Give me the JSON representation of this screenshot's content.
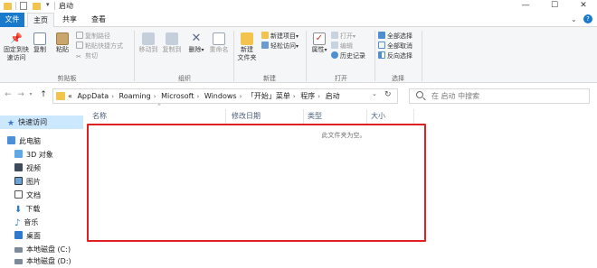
{
  "window": {
    "title": "启动",
    "min_glyph": "—",
    "max_glyph": "☐",
    "close_glyph": "✕"
  },
  "tabs": {
    "file": "文件",
    "home": "主页",
    "share": "共享",
    "view": "查看"
  },
  "ribbon": {
    "clipboard": {
      "pin": "固定到快\n速访问",
      "copy": "复制",
      "paste": "粘贴",
      "copy_path": "复制路径",
      "paste_shortcut": "粘贴快捷方式",
      "cut": "剪切",
      "label": "剪贴板"
    },
    "organize": {
      "move_to": "移动到",
      "copy_to": "复制到",
      "delete": "删除",
      "rename": "重命名",
      "label": "组织"
    },
    "new": {
      "new_folder": "新建\n文件夹",
      "new_item": "新建项目",
      "easy_access": "轻松访问",
      "label": "新建"
    },
    "open": {
      "properties": "属性",
      "open": "打开",
      "edit": "编辑",
      "history": "历史记录",
      "label": "打开"
    },
    "select": {
      "select_all": "全部选择",
      "select_none": "全部取消",
      "invert": "反向选择",
      "label": "选择"
    }
  },
  "address": {
    "crumbs": [
      "«",
      "AppData",
      "Roaming",
      "Microsoft",
      "Windows",
      "「开始」菜单",
      "程序",
      "启动"
    ],
    "search_placeholder": "在 启动 中搜索"
  },
  "navpane": {
    "quick_access": "快速访问",
    "this_pc": "此电脑",
    "objects_3d": "3D 对象",
    "videos": "视频",
    "pictures": "图片",
    "documents": "文档",
    "downloads": "下载",
    "music": "音乐",
    "desktop": "桌面",
    "disk_c": "本地磁盘 (C:)",
    "disk_d": "本地磁盘 (D:)"
  },
  "content": {
    "columns": {
      "name": "名称",
      "modified": "修改日期",
      "type": "类型",
      "size": "大小"
    },
    "empty_message": "此文件夹为空。"
  },
  "colors": {
    "accent": "#1979ca",
    "highlight_border": "#e02020",
    "selected_bg": "#cce8ff"
  }
}
